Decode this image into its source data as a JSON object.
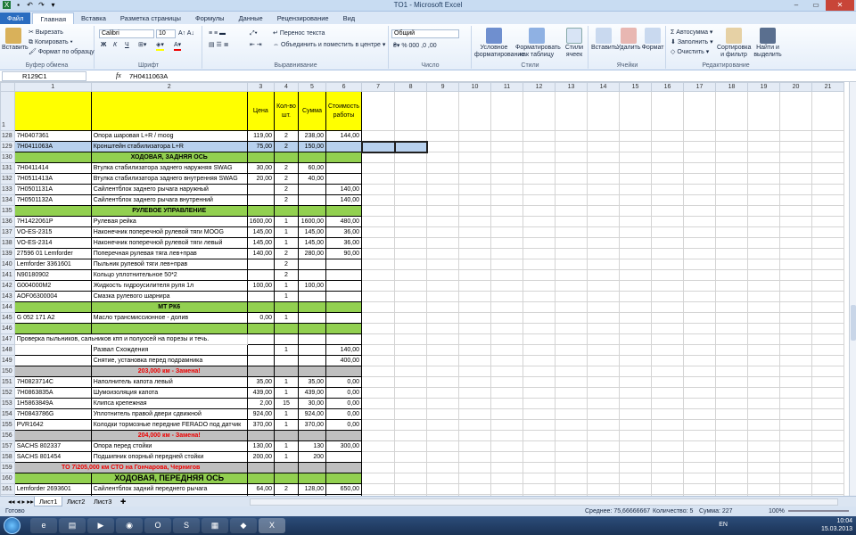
{
  "app": {
    "title": "TO1 - Microsoft Excel",
    "quick_access": [
      "save-icon",
      "undo-icon",
      "redo-icon",
      "customize-icon"
    ]
  },
  "tabs": [
    "Файл",
    "Главная",
    "Вставка",
    "Разметка страницы",
    "Формулы",
    "Данные",
    "Рецензирование",
    "Вид"
  ],
  "ribbon": {
    "clipboard": {
      "paste": "Вставить",
      "cut": "Вырезать",
      "copy": "Копировать",
      "format_painter": "Формат по образцу",
      "label": "Буфер обмена"
    },
    "font": {
      "name": "Calibri",
      "size": "10",
      "bold": "Ж",
      "italic": "К",
      "underline": "Ч",
      "label": "Шрифт"
    },
    "alignment": {
      "wrap": "Перенос текста",
      "merge": "Объединить и поместить в центре",
      "label": "Выравнивание"
    },
    "number": {
      "format": "Общий",
      "label": "Число"
    },
    "styles": {
      "cond": "Условное форматирование",
      "table": "Форматировать как таблицу",
      "cell": "Стили ячеек",
      "label": "Стили"
    },
    "cells": {
      "insert": "Вставить",
      "delete": "Удалить",
      "format": "Формат",
      "label": "Ячейки"
    },
    "editing": {
      "autosum": "Автосумма",
      "fill": "Заполнить",
      "clear": "Очистить",
      "sort": "Сортировка и фильтр",
      "find": "Найти и выделить",
      "label": "Редактирование"
    }
  },
  "formula_bar": {
    "name_box": "R129C1",
    "fx": "fx",
    "value": "7H0411063A"
  },
  "col_headers": [
    "1",
    "2",
    "3",
    "4",
    "5",
    "6",
    "7",
    "8",
    "9",
    "10",
    "11",
    "12",
    "13",
    "14",
    "15",
    "16",
    "17",
    "18",
    "19",
    "20",
    "21"
  ],
  "header_row": {
    "row": "1",
    "c3": "Цена",
    "c4": "Кол-во шт.",
    "c5": "Сумма",
    "c6": "Стоимость работы"
  },
  "rows": [
    {
      "r": "128",
      "a": "7H0407361",
      "b": "Опора шаровая L+R / moog",
      "c": "119,00",
      "d": "2",
      "e": "238,00",
      "f": "144,00",
      "t": "n"
    },
    {
      "r": "129",
      "a": "7H0411063A",
      "b": "Кронштейн стабилизатора L+R",
      "c": "75,00",
      "d": "2",
      "e": "150,00",
      "f": "",
      "t": "sel"
    },
    {
      "r": "130",
      "a": "",
      "b": "ХОДОВАЯ, ЗАДНЯЯ ОСЬ",
      "c": "",
      "d": "",
      "e": "",
      "f": "",
      "t": "green"
    },
    {
      "r": "131",
      "a": "7H0411414",
      "b": "Втулка стабилизатора заднего наружняя  SWAG",
      "c": "30,00",
      "d": "2",
      "e": "60,00",
      "f": "",
      "t": "n"
    },
    {
      "r": "132",
      "a": "7H0511413A",
      "b": "Втулка стабилизатора заднего внутренняя SWAG",
      "c": "20,00",
      "d": "2",
      "e": "40,00",
      "f": "",
      "t": "n"
    },
    {
      "r": "133",
      "a": "7H0501131A",
      "b": "Сайлентблок заднего рычага наружный",
      "c": "",
      "d": "2",
      "e": "",
      "f": "140,00",
      "t": "n"
    },
    {
      "r": "134",
      "a": "7H0501132A",
      "b": "Сайлентблок заднего рычага внутренний",
      "c": "",
      "d": "2",
      "e": "",
      "f": "140,00",
      "t": "n"
    },
    {
      "r": "135",
      "a": "",
      "b": "РУЛЕВОЕ УПРАВЛЕНИЕ",
      "c": "",
      "d": "",
      "e": "",
      "f": "",
      "t": "green"
    },
    {
      "r": "136",
      "a": "7H1422061P",
      "b": "Рулевая рейка",
      "c": "1600,00",
      "d": "1",
      "e": "1600,00",
      "f": "480,00",
      "t": "n"
    },
    {
      "r": "137",
      "a": "VO-ES-2315",
      "b": "Наконечник поперечной рулевой тяги MOOG",
      "c": "145,00",
      "d": "1",
      "e": "145,00",
      "f": "36,00",
      "t": "n"
    },
    {
      "r": "138",
      "a": "VO-ES-2314",
      "b": "Наконечник поперечной рулевой тяги левый",
      "c": "145,00",
      "d": "1",
      "e": "145,00",
      "f": "36,00",
      "t": "n"
    },
    {
      "r": "139",
      "a": "27596 01 Lemforder",
      "b": "Поперечная рулевая тяга лев+прав",
      "c": "140,00",
      "d": "2",
      "e": "280,00",
      "f": "90,00",
      "t": "n"
    },
    {
      "r": "140",
      "a": "Lemforder 3361601",
      "b": "Пыльник рулевой тяги лев+прав",
      "c": "",
      "d": "2",
      "e": "",
      "f": "",
      "t": "n"
    },
    {
      "r": "141",
      "a": "N90180902",
      "b": "Кольцо уплотнительное 50*2",
      "c": "",
      "d": "2",
      "e": "",
      "f": "",
      "t": "n"
    },
    {
      "r": "142",
      "a": "G004000M2",
      "b": "Жидкость гидроусилителя руля 1л",
      "c": "100,00",
      "d": "1",
      "e": "100,00",
      "f": "",
      "t": "n"
    },
    {
      "r": "143",
      "a": "AOF06300004",
      "b": "Смазка рулевого шарнира",
      "c": "",
      "d": "1",
      "e": "",
      "f": "",
      "t": "n"
    },
    {
      "r": "144",
      "a": "",
      "b": "МТ РК6",
      "c": "",
      "d": "",
      "e": "",
      "f": "",
      "t": "green"
    },
    {
      "r": "145",
      "a": "G 052 171 A2",
      "b": "Масло трансмиссионное - долив",
      "c": "0,00",
      "d": "1",
      "e": "",
      "f": "",
      "t": "n"
    },
    {
      "r": "146",
      "a": "",
      "b": "",
      "c": "",
      "d": "",
      "e": "",
      "f": "",
      "t": "green"
    },
    {
      "r": "147",
      "a": "Проверка пыльников, сальников кпп и полуосей на порезы и течь.",
      "b": "",
      "c": "",
      "d": "",
      "e": "",
      "f": "",
      "t": "span"
    },
    {
      "r": "148",
      "a": "",
      "b": "Развал Схождения",
      "c": "",
      "d": "1",
      "e": "",
      "f": "140,00",
      "t": "n"
    },
    {
      "r": "149",
      "a": "",
      "b": "Снятие, установка перед подрамника",
      "c": "",
      "d": "",
      "e": "",
      "f": "400,00",
      "t": "n"
    },
    {
      "r": "150",
      "a": "",
      "b": "203,000 км - Замена!",
      "c": "",
      "d": "",
      "e": "",
      "f": "",
      "t": "grey"
    },
    {
      "r": "151",
      "a": "7H0823714C",
      "b": "Наполнитель капота левый",
      "c": "35,00",
      "d": "1",
      "e": "35,00",
      "f": "0,00",
      "t": "n"
    },
    {
      "r": "152",
      "a": "7H0863835A",
      "b": "Шумоизоляция капота",
      "c": "439,00",
      "d": "1",
      "e": "439,00",
      "f": "0,00",
      "t": "n"
    },
    {
      "r": "153",
      "a": "1H5863849A",
      "b": "Клипса крепежная",
      "c": "2,00",
      "d": "15",
      "e": "30,00",
      "f": "0,00",
      "t": "n"
    },
    {
      "r": "154",
      "a": "7H0843786G",
      "b": "Уплотнитель правой двери сдвижной",
      "c": "924,00",
      "d": "1",
      "e": "924,00",
      "f": "0,00",
      "t": "n"
    },
    {
      "r": "155",
      "a": "PVR1642",
      "b": "Колодки тормозные передние FERADO под датчик",
      "c": "370,00",
      "d": "1",
      "e": "370,00",
      "f": "0,00",
      "t": "n"
    },
    {
      "r": "156",
      "a": "",
      "b": "204,000 км - Замена!",
      "c": "",
      "d": "",
      "e": "",
      "f": "",
      "t": "grey"
    },
    {
      "r": "157",
      "a": "SACHS 802337",
      "b": "Опора перед стойки",
      "c": "130,00",
      "d": "1",
      "e": "130",
      "f": "300,00",
      "t": "n"
    },
    {
      "r": "158",
      "a": "SACHS 801454",
      "b": "Подшипник опорный передней стойки",
      "c": "200,00",
      "d": "1",
      "e": "200",
      "f": "",
      "t": "n"
    },
    {
      "r": "159",
      "a": "",
      "b": "ТО 7\\205,000 км СТО на Гончарова, Чернигов",
      "c": "",
      "d": "",
      "e": "",
      "f": "",
      "t": "greyspan"
    },
    {
      "r": "160",
      "a": "",
      "b": "ХОДОВАЯ, ПЕРЕДНЯЯ ОСЬ",
      "c": "",
      "d": "",
      "e": "",
      "f": "",
      "t": "green2"
    },
    {
      "r": "161",
      "a": "Lemforder 2693601",
      "b": "Сайлентблок задний переднего рычага",
      "c": "64,00",
      "d": "2",
      "e": "128,00",
      "f": "650,00",
      "t": "n"
    },
    {
      "r": "162",
      "a": "",
      "b": "Монтажный комплект амортизатора (Опора +",
      "c": "",
      "d": "",
      "e": "",
      "f": "",
      "t": "n"
    }
  ],
  "sheets": [
    "Лист1",
    "Лист2",
    "Лист3"
  ],
  "status": {
    "ready": "Готово",
    "avg": "Среднее: 75,66666667",
    "count": "Количество: 5",
    "sum": "Сумма: 227",
    "zoom": "100%"
  },
  "taskbar": {
    "lang": "EN",
    "time": "10:04",
    "date": "15.03.2013"
  }
}
